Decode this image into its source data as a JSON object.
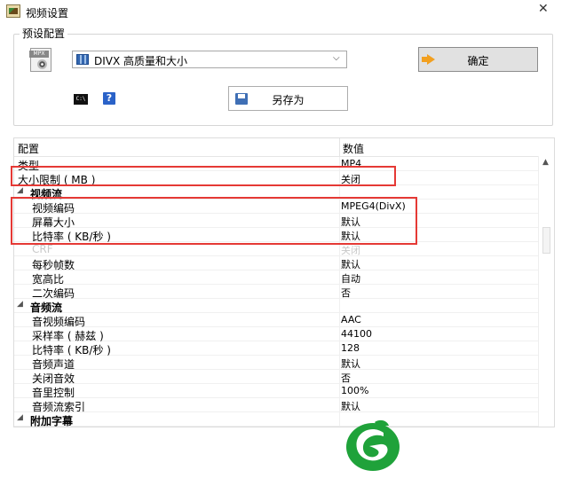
{
  "window": {
    "title": "视频设置",
    "close_glyph": "✕"
  },
  "preset": {
    "group_label": "预设配置",
    "icon_tag": "MPX",
    "selected_value": "DIVX 高质量和大小",
    "dropdown_arrow": "⌵",
    "ok_label": "确定",
    "cmd_icon_text": "C:\\",
    "help_icon_text": "?",
    "save_as_label": "另存为"
  },
  "grid": {
    "headers": {
      "name": "配置",
      "value": "数值"
    },
    "rows": [
      {
        "kind": "top",
        "name": "类型",
        "value": "MP4"
      },
      {
        "kind": "top",
        "name": "大小限制 ( MB )",
        "value": "关闭"
      },
      {
        "kind": "cat",
        "name": "视频流",
        "value": ""
      },
      {
        "kind": "item",
        "name": "视频编码",
        "value": "MPEG4(DivX)"
      },
      {
        "kind": "item",
        "name": "屏幕大小",
        "value": "默认"
      },
      {
        "kind": "item",
        "name": "比特率 ( KB/秒 )",
        "value": "默认"
      },
      {
        "kind": "dim",
        "name": "CRF",
        "value": "关闭"
      },
      {
        "kind": "item",
        "name": "每秒帧数",
        "value": "默认"
      },
      {
        "kind": "item",
        "name": "宽高比",
        "value": "自动"
      },
      {
        "kind": "item",
        "name": "二次编码",
        "value": "否"
      },
      {
        "kind": "cat",
        "name": "音频流",
        "value": ""
      },
      {
        "kind": "item",
        "name": "音视频编码",
        "value": "AAC"
      },
      {
        "kind": "item",
        "name": "采样率 ( 赫兹 )",
        "value": "44100"
      },
      {
        "kind": "item",
        "name": "比特率 ( KB/秒 )",
        "value": "128"
      },
      {
        "kind": "item",
        "name": "音频声道",
        "value": "默认"
      },
      {
        "kind": "item",
        "name": "关闭音效",
        "value": "否"
      },
      {
        "kind": "item",
        "name": "音里控制",
        "value": "100%"
      },
      {
        "kind": "item",
        "name": "音频流索引",
        "value": "默认"
      },
      {
        "kind": "cat",
        "name": "附加字幕",
        "value": ""
      }
    ]
  },
  "colors": {
    "highlight": "#e53935",
    "logo_green": "#1fa23a"
  },
  "icons": [
    "app-icon",
    "mpx-file-icon",
    "film-icon",
    "chevron-down-icon",
    "ok-arrow-icon",
    "command-prompt-icon",
    "help-icon",
    "save-disk-icon",
    "scroll-up-icon",
    "collapse-triangle-icon",
    "logo"
  ]
}
